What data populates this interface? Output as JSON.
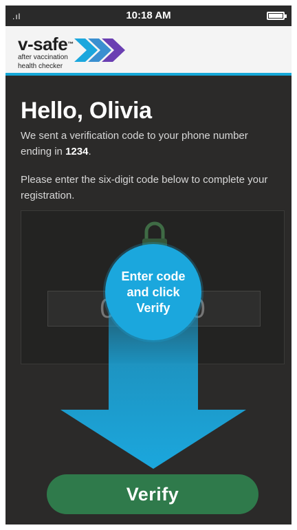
{
  "status_bar": {
    "signal": ".ıl",
    "time": "10:18 AM"
  },
  "app": {
    "logo_name": "v-safe",
    "logo_tm": "™",
    "logo_tagline_1": "after vaccination",
    "logo_tagline_2": "health checker"
  },
  "screen": {
    "greeting": "Hello, Olivia",
    "message_1_prefix": "We sent a verification code to your phone number ending in ",
    "message_1_number": "1234",
    "message_1_suffix": ".",
    "message_2": "Please enter the six-digit code below to complete your registration.",
    "code_placeholder": "000000",
    "callout": "Enter code and click Verify",
    "verify_label": "Verify"
  },
  "colors": {
    "accent_blue": "#16a8d8",
    "verify_green": "#2f7a4b",
    "background": "#2b2a29"
  }
}
